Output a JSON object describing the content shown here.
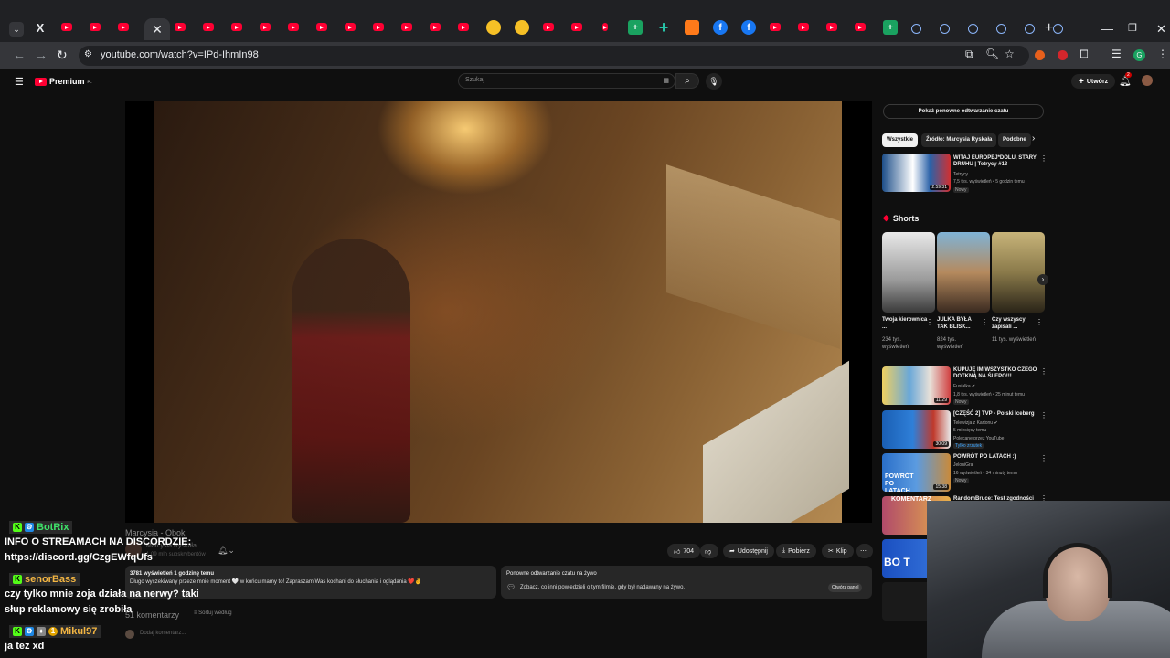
{
  "browser": {
    "tab_icons": [
      "x",
      "yt",
      "yt",
      "yt",
      "active",
      "yt",
      "yt",
      "yt",
      "yt",
      "yt",
      "yt",
      "yt",
      "yt",
      "yt",
      "yt",
      "yt",
      "yellow",
      "yellow",
      "yt",
      "yt",
      "red-pin",
      "green",
      "plus",
      "orange",
      "fb",
      "fb",
      "yt",
      "yt",
      "yt",
      "yt",
      "green",
      "globe",
      "globe",
      "globe",
      "globe",
      "globe",
      "globe"
    ],
    "active_tab_close": "✕",
    "new_tab": "+",
    "url": "youtube.com/watch?v=IPd-IhmIn98"
  },
  "youtube": {
    "logo_text": "Premium",
    "logo_suffix": "PL",
    "search_placeholder": "Szukaj",
    "create_label": "Utwórz",
    "notifications_count": "2"
  },
  "chat_overlay": [
    {
      "user": "BotRix",
      "color": "#3fe36a",
      "message": "INFO O STREAMACH NA DISCORDZIE:\nhttps://discord.gg/CzgEWfqUfs"
    },
    {
      "user": "senorBass",
      "color": "#f4b642",
      "message": "czy tylko mnie zoja działa na nerwy? taki słup reklamowy się zrobiła"
    },
    {
      "user": "Mikul97",
      "color": "#f4b642",
      "message": "ja tez xd"
    }
  ],
  "video": {
    "channel_title": "Marcysia - Obok",
    "channel_name": "Marcysia Ryskała",
    "subscribers": "1,09 mln subskrybentów",
    "likes": "704",
    "share_label": "Udostępnij",
    "download_label": "Pobierz",
    "clip_label": "Klip",
    "description_views": "3781 wyświetleń  1 godzinę temu",
    "description_text": "Długo wyczekiwany przeze mnie moment 🤍 w końcu mamy to! Zapraszam Was kochani do słuchania i oglądania ❤️✌️",
    "replay_title": "Ponowne odtwarzanie czatu na żywo",
    "replay_desc": "Zobacz, co inni powiedzieli o tym filmie, gdy był nadawany na żywo.",
    "open_panel_label": "Otwórz panel",
    "comments_count": "51 komentarzy",
    "sort_label": "Sortuj według",
    "add_comment_placeholder": "Dodaj komentarz..."
  },
  "sidebar": {
    "replay_button": "Pokaż ponowne odtwarzanie czatu",
    "chips": [
      "Wszystkie",
      "Źródło: Marcysia Ryskała",
      "Podobne"
    ],
    "videos": [
      {
        "title": "WITAJ EUROPEJ*DOLU, STARY DRUHU | Tetrycy #13",
        "channel": "Tetrycy",
        "meta": "7,5 tys. wyświetleń • 5 godzin temu",
        "badge": "Nowy",
        "duration": "2:59:31"
      },
      {
        "title": "KUPUJĘ IM WSZYSTKO CZEGO DOTKNĄ NA ŚLEPO!!!",
        "channel": "Fusialka ✔",
        "meta": "1,8 tys. wyświetleń • 25 minut temu",
        "badge": "Nowy",
        "duration": "11:29"
      },
      {
        "title": "[CZĘŚĆ 2] TVP - Polski Iceberg",
        "channel": "Telewizja z Kartonu ✔",
        "meta": "5 miesięcy temu",
        "extra": "Polecane przez YouTube",
        "badge": "Tylko zrzutek",
        "duration": "30:09"
      },
      {
        "title": "POWRÓT PO LATACH :)",
        "channel": "JeloniGra",
        "meta": "16 wyświetleń • 34 minuty temu",
        "badge": "Nowy",
        "duration": "15:38"
      },
      {
        "title": "RandomBruce: Test zgodności z",
        "channel": "",
        "meta": "",
        "badge": "",
        "duration": ""
      }
    ],
    "shorts_title": "Shorts",
    "shorts": [
      {
        "title": "Twoja kierownica ...",
        "views": "234 tys. wyświetleń"
      },
      {
        "title": "JULKA BYŁA TAK BLISK...",
        "views": "824 tys. wyświetleń"
      },
      {
        "title": "Czy wszyscy zapisali ...",
        "views": "11 tys. wyświetleń"
      }
    ],
    "thumb_texts": [
      "POWRÓT PO LATACH",
      "KOMENTARZ",
      "BO T"
    ]
  }
}
